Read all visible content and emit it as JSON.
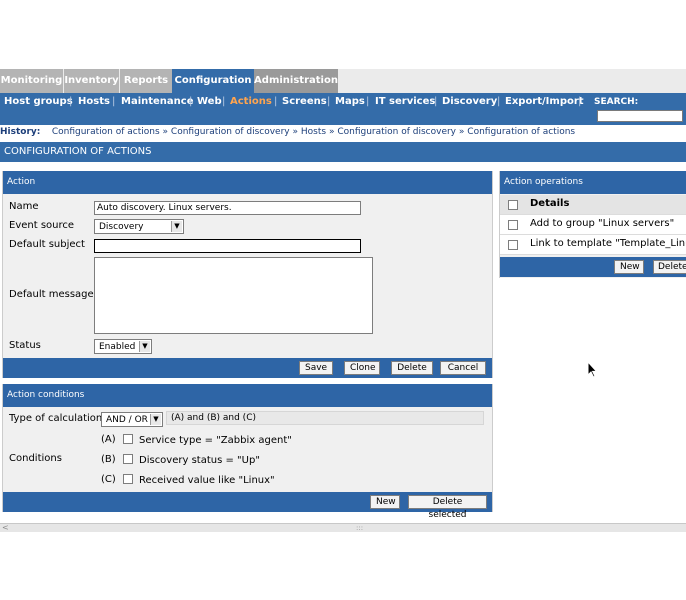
{
  "main_tabs": [
    {
      "label": "Monitoring"
    },
    {
      "label": "Inventory"
    },
    {
      "label": "Reports"
    },
    {
      "label": "Configuration"
    },
    {
      "label": "Administration"
    }
  ],
  "sub_menu": [
    {
      "label": "Host groups"
    },
    {
      "label": "Hosts"
    },
    {
      "label": "Maintenance"
    },
    {
      "label": "Web"
    },
    {
      "label": "Actions"
    },
    {
      "label": "Screens"
    },
    {
      "label": "Maps"
    },
    {
      "label": "IT services"
    },
    {
      "label": "Discovery"
    },
    {
      "label": "Export/Import"
    }
  ],
  "search": {
    "label": "SEARCH:",
    "value": ""
  },
  "history": {
    "label": "History:",
    "links": [
      "Configuration of actions",
      "Configuration of discovery",
      "Hosts",
      "Configuration of discovery",
      "Configuration of actions"
    ]
  },
  "page_title": "CONFIGURATION OF ACTIONS",
  "action": {
    "header": "Action",
    "name_label": "Name",
    "name_value": "Auto discovery. Linux servers.",
    "event_source_label": "Event source",
    "event_source_value": "Discovery",
    "default_subject_label": "Default subject",
    "default_subject_value": "",
    "default_message_label": "Default message",
    "default_message_value": "",
    "status_label": "Status",
    "status_value": "Enabled",
    "buttons": {
      "save": "Save",
      "clone": "Clone",
      "delete": "Delete",
      "cancel": "Cancel"
    }
  },
  "conditions": {
    "header": "Action conditions",
    "type_label": "Type of calculation",
    "type_value": "AND / OR",
    "formula": "(A) and (B) and (C)",
    "conditions_label": "Conditions",
    "items": [
      {
        "letter": "(A)",
        "text": "Service type = \"Zabbix agent\""
      },
      {
        "letter": "(B)",
        "text": "Discovery status = \"Up\""
      },
      {
        "letter": "(C)",
        "text": "Received value like \"Linux\""
      }
    ],
    "buttons": {
      "new": "New",
      "delete_selected": "Delete selected"
    }
  },
  "operations": {
    "header": "Action operations",
    "column": "Details",
    "rows": [
      {
        "text": "Add to group \"Linux servers\""
      },
      {
        "text": "Link to template \"Template_Linux\""
      }
    ],
    "buttons": {
      "new": "New",
      "delete": "Delete"
    }
  },
  "colors": {
    "primary": "#346ca9",
    "panel_header": "#2e65a6",
    "active_menu": "#ffa54f",
    "inactive_tab": "#b4b4b4",
    "panel_bg": "#f0f0f0"
  },
  "icons": [
    "checkbox-icon",
    "dropdown-arrow-icon",
    "mouse-cursor-icon",
    "scroll-grip-icon"
  ]
}
